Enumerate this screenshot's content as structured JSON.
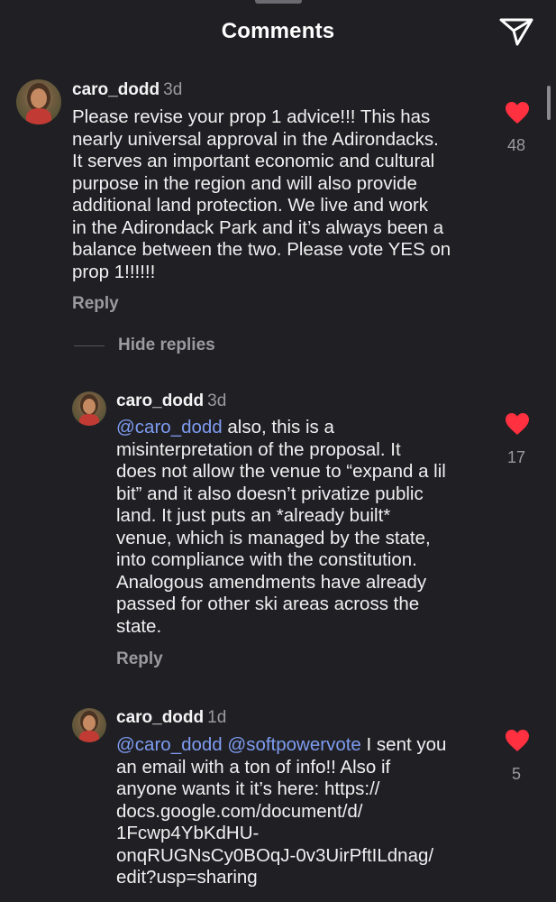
{
  "header": {
    "title": "Comments"
  },
  "comments": [
    {
      "username": "caro_dodd",
      "age": "3d",
      "mentions": "",
      "lines": [
        "Please revise your prop 1 advice!!! This has",
        "nearly universal approval in the Adirondacks.",
        "It serves an important economic and cultural",
        "purpose in the region and will also provide",
        "additional land protection. We live and work",
        "in the Adirondack Park and it’s always been a",
        "balance between the two. Please vote YES on",
        "prop 1!!!!!!"
      ],
      "likes": "48",
      "reply_label": "Reply"
    },
    {
      "username": "caro_dodd",
      "age": "3d",
      "mentions": "@caro_dodd",
      "lines": [
        " also, this is a",
        "misinterpretation of the proposal. It",
        "does not allow the venue to “expand a lil",
        "bit” and it also doesn’t privatize public",
        "land. It just puts an *already built*",
        "venue, which is managed by the state,",
        "into compliance with the constitution.",
        "Analogous amendments have already",
        "passed for other ski areas across the",
        "state."
      ],
      "likes": "17",
      "reply_label": "Reply"
    },
    {
      "username": "caro_dodd",
      "age": "1d",
      "mentions": "@caro_dodd @softpowervote",
      "lines": [
        " I sent you",
        "an email with a ton of info!! Also if",
        "anyone wants it it’s here: https://",
        "docs.google.com/document/d/",
        "1Fcwp4YbKdHU-",
        "onqRUGNsCy0BOqJ-0v3UirPftILdnag/",
        "edit?usp=sharing"
      ],
      "likes": "5"
    }
  ],
  "hide_replies_label": "Hide replies",
  "colors": {
    "background": "#1f1f24",
    "heart": "#ff3040",
    "mention": "#7e9cf0",
    "muted": "#9a9aa0"
  },
  "icons": [
    "share-direct-icon",
    "heart-filled-icon"
  ]
}
